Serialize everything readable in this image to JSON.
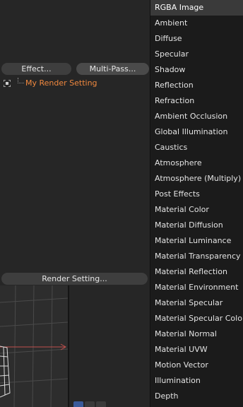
{
  "buttons": {
    "effect": "Effect...",
    "multipass": "Multi-Pass...",
    "render_setting": "Render Setting..."
  },
  "tree": {
    "item_label": "My Render Setting"
  },
  "colors": {
    "tree_item_accent": "#f0883e",
    "axis_x": "#c0504d",
    "active_view_icon": "#3a5a9a"
  },
  "dropdown": {
    "selected_index": 0,
    "items": [
      "RGBA Image",
      "Ambient",
      "Diffuse",
      "Specular",
      "Shadow",
      "Reflection",
      "Refraction",
      "Ambient Occlusion",
      "Global Illumination",
      "Caustics",
      "Atmosphere",
      "Atmosphere (Multiply)",
      "Post Effects",
      "Material Color",
      "Material Diffusion",
      "Material Luminance",
      "Material Transparency",
      "Material Reflection",
      "Material Environment",
      "Material Specular",
      "Material Specular Color",
      "Material Normal",
      "Material UVW",
      "Motion Vector",
      "Illumination",
      "Depth"
    ]
  },
  "view_icons": [
    "list-view-icon",
    "tile-view-icon",
    "frame-view-icon"
  ]
}
